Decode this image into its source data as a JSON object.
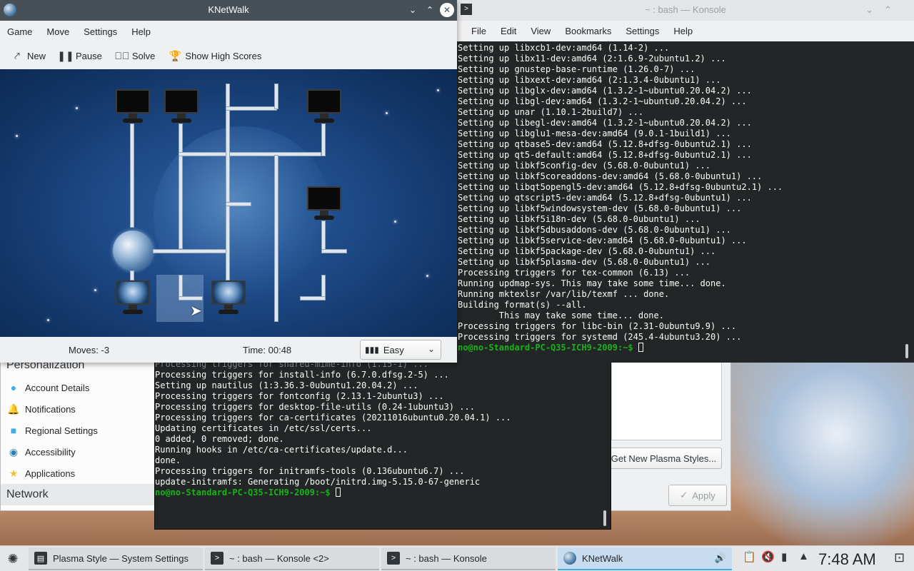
{
  "settings": {
    "sidebar": {
      "categories": [
        "Personalization",
        "Network"
      ],
      "items": [
        {
          "label": "Account Details",
          "icon": "user-icon"
        },
        {
          "label": "Notifications",
          "icon": "bell-icon"
        },
        {
          "label": "Regional Settings",
          "icon": "flag-icon"
        },
        {
          "label": "Accessibility",
          "icon": "accessibility-icon"
        },
        {
          "label": "Applications",
          "icon": "star-icon"
        }
      ]
    },
    "get_new_label": "Get New Plasma Styles...",
    "apply_label": "Apply"
  },
  "konsole2": {
    "lines": [
      "Processing triggers for shared-mime-info (1.15-1) ...",
      "Processing triggers for install-info (6.7.0.dfsg.2-5) ...",
      "Setting up nautilus (1:3.36.3-0ubuntu1.20.04.2) ...",
      "Processing triggers for fontconfig (2.13.1-2ubuntu3) ...",
      "Processing triggers for desktop-file-utils (0.24-1ubuntu3) ...",
      "Processing triggers for ca-certificates (20211016ubuntu0.20.04.1) ...",
      "Updating certificates in /etc/ssl/certs...",
      "0 added, 0 removed; done.",
      "Running hooks in /etc/ca-certificates/update.d...",
      "done.",
      "Processing triggers for initramfs-tools (0.136ubuntu6.7) ...",
      "update-initramfs: Generating /boot/initrd.img-5.15.0-67-generic"
    ],
    "prompt": "no@no-Standard-PC-Q35-ICH9-2009:~$"
  },
  "konsole1": {
    "title": "~ : bash — Konsole",
    "menu": [
      "File",
      "Edit",
      "View",
      "Bookmarks",
      "Settings",
      "Help"
    ],
    "lines": [
      "Setting up libxcb1-dev:amd64 (1.14-2) ...",
      "Setting up libx11-dev:amd64 (2:1.6.9-2ubuntu1.2) ...",
      "Setting up gnustep-base-runtime (1.26.0-7) ...",
      "Setting up libxext-dev:amd64 (2:1.3.4-0ubuntu1) ...",
      "Setting up libglx-dev:amd64 (1.3.2-1~ubuntu0.20.04.2) ...",
      "Setting up libgl-dev:amd64 (1.3.2-1~ubuntu0.20.04.2) ...",
      "Setting up unar (1.10.1-2build7) ...",
      "Setting up libegl-dev:amd64 (1.3.2-1~ubuntu0.20.04.2) ...",
      "Setting up libglu1-mesa-dev:amd64 (9.0.1-1build1) ...",
      "Setting up qtbase5-dev:amd64 (5.12.8+dfsg-0ubuntu2.1) ...",
      "Setting up qt5-default:amd64 (5.12.8+dfsg-0ubuntu2.1) ...",
      "Setting up libkf5config-dev (5.68.0-0ubuntu1) ...",
      "Setting up libkf5coreaddons-dev:amd64 (5.68.0-0ubuntu1) ...",
      "Setting up libqt5opengl5-dev:amd64 (5.12.8+dfsg-0ubuntu2.1) ...",
      "Setting up qtscript5-dev:amd64 (5.12.8+dfsg-0ubuntu1) ...",
      "Setting up libkf5windowsystem-dev (5.68.0-0ubuntu1) ...",
      "Setting up libkf5i18n-dev (5.68.0-0ubuntu1) ...",
      "Setting up libkf5dbusaddons-dev (5.68.0-0ubuntu1) ...",
      "Setting up libkf5service-dev:amd64 (5.68.0-0ubuntu1) ...",
      "Setting up libkf5package-dev (5.68.0-0ubuntu1) ...",
      "Setting up libkf5plasma-dev (5.68.0-0ubuntu1) ...",
      "Processing triggers for tex-common (6.13) ...",
      "Running updmap-sys. This may take some time... done.",
      "Running mktexlsr /var/lib/texmf ... done.",
      "Building format(s) --all.",
      "        This may take some time... done.",
      "Processing triggers for libc-bin (2.31-0ubuntu9.9) ...",
      "Processing triggers for systemd (245.4-4ubuntu3.20) ..."
    ],
    "prompt": "no@no-Standard-PC-Q35-ICH9-2009:~$"
  },
  "knetwalk": {
    "title": "KNetWalk",
    "menu": [
      "Game",
      "Move",
      "Settings",
      "Help"
    ],
    "toolbar": [
      {
        "label": "New",
        "icon": "new-icon"
      },
      {
        "label": "Pause",
        "icon": "pause-icon"
      },
      {
        "label": "Solve",
        "icon": "check-circle-icon"
      },
      {
        "label": "Show High Scores",
        "icon": "trophy-icon"
      }
    ],
    "moves": "Moves: -3",
    "time": "Time: 00:48",
    "difficulty": "Easy"
  },
  "taskbar": {
    "tasks": [
      {
        "label": "Plasma Style  — System Settings",
        "active": false
      },
      {
        "label": "~ : bash — Konsole <2>",
        "active": false
      },
      {
        "label": "~ : bash — Konsole",
        "active": false
      },
      {
        "label": "KNetWalk",
        "active": true
      }
    ],
    "clock": "7:48 AM"
  },
  "colors": {
    "accent": "#3daee9",
    "prompt_green": "#18b218",
    "terminal_bg": "#232627",
    "titlebar_active": "#475057"
  }
}
